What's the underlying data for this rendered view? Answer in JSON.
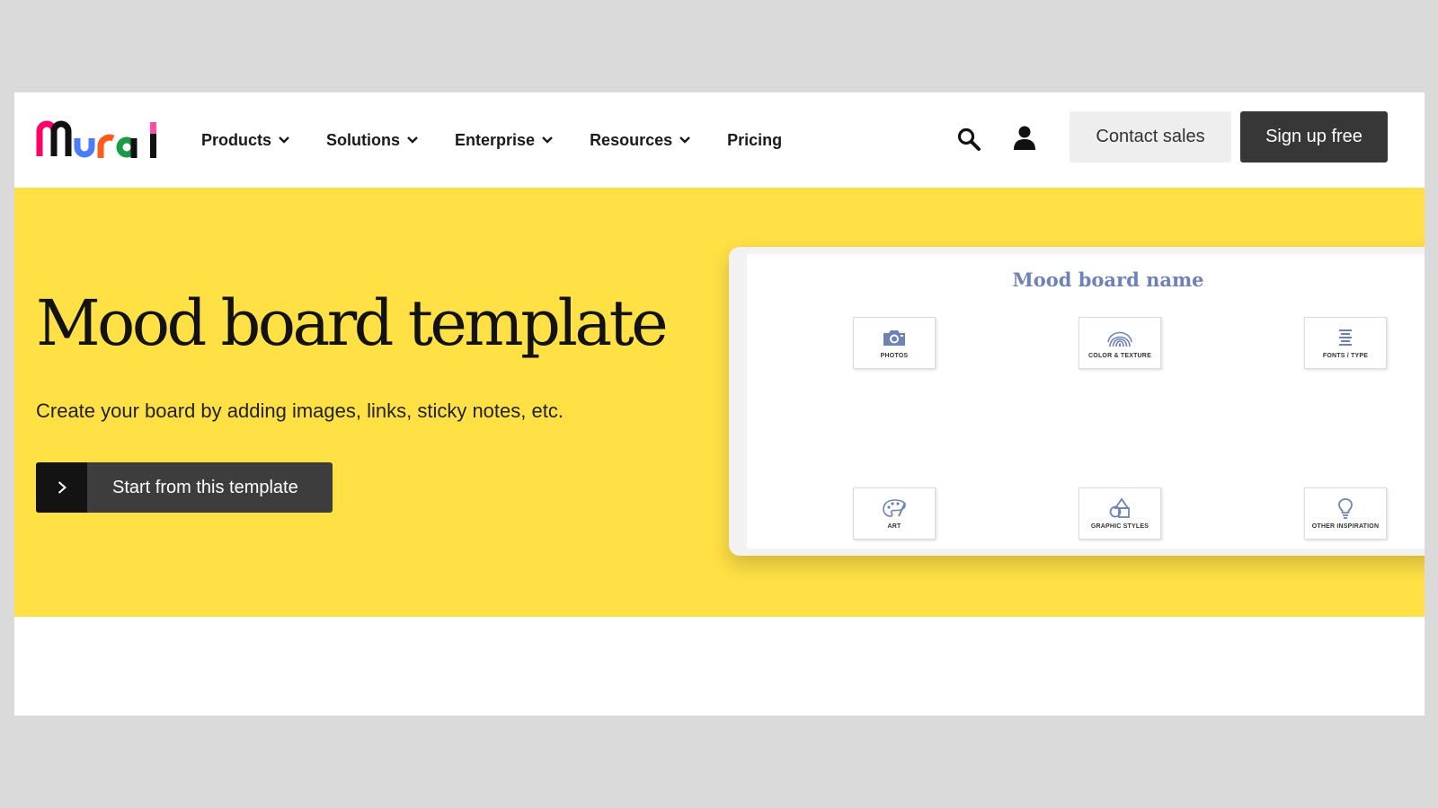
{
  "brand": {
    "name": "Mural"
  },
  "nav": {
    "items": [
      {
        "label": "Products",
        "has_dropdown": true
      },
      {
        "label": "Solutions",
        "has_dropdown": true
      },
      {
        "label": "Enterprise",
        "has_dropdown": true
      },
      {
        "label": "Resources",
        "has_dropdown": true
      },
      {
        "label": "Pricing",
        "has_dropdown": false
      }
    ],
    "icons": [
      "search-icon",
      "user-icon",
      "chevron-down-icon"
    ],
    "contact_label": "Contact sales",
    "signup_label": "Sign up free"
  },
  "hero": {
    "title": "Mood board template",
    "subtitle": "Create your board by adding images, links, sticky notes, etc.",
    "cta_label": "Start from this template",
    "cta_icon": "chevron-right-icon"
  },
  "preview": {
    "board_title": "Mood board name",
    "cards": [
      {
        "label": "PHOTOS",
        "icon": "camera-icon"
      },
      {
        "label": "COLOR & TEXTURE",
        "icon": "fingerprint-icon"
      },
      {
        "label": "FONTS / TYPE",
        "icon": "lines-icon"
      },
      {
        "label": "ART",
        "icon": "palette-icon"
      },
      {
        "label": "GRAPHIC STYLES",
        "icon": "shapes-icon"
      },
      {
        "label": "OTHER INSPIRATION",
        "icon": "lightbulb-icon"
      }
    ]
  },
  "colors": {
    "hero_background": "#ffe045",
    "board_accent": "#6f82b8",
    "signup_button": "#373737",
    "contact_button": "#eeeeee",
    "logo": [
      "#ff0066",
      "#111111",
      "#4a7cff",
      "#ff5a1f",
      "#1a9b48",
      "#ff4fa3"
    ]
  }
}
